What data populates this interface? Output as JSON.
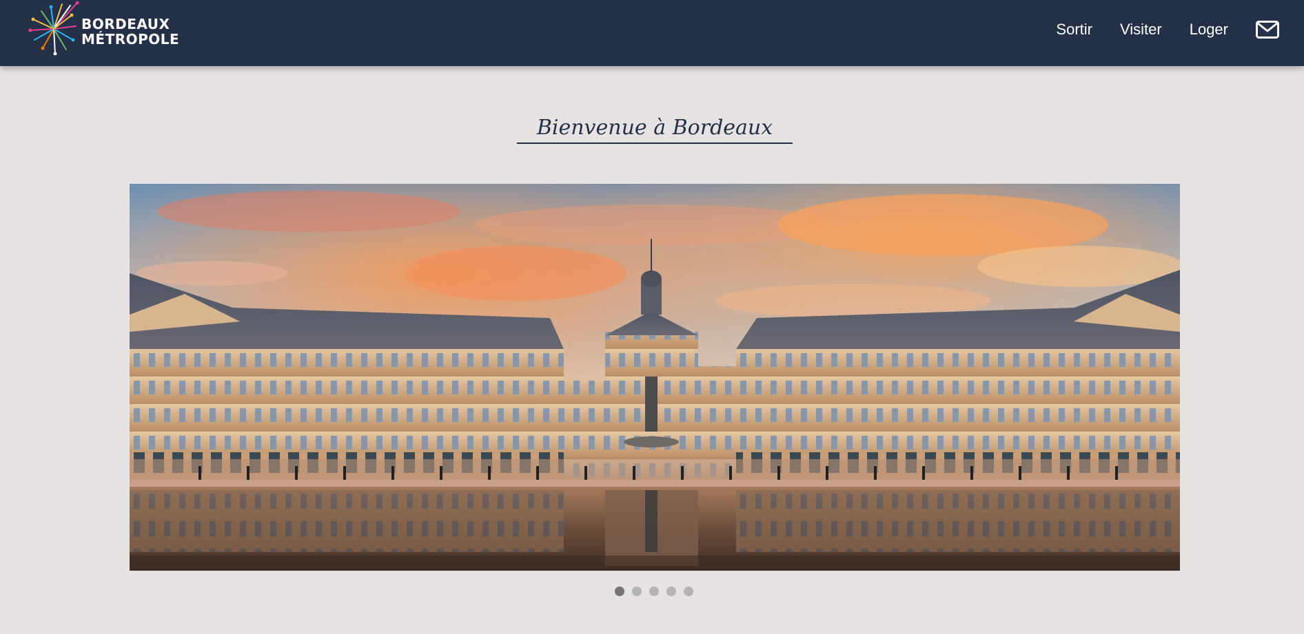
{
  "header": {
    "logo_line1": "BORDEAUX",
    "logo_line2": "MÉTROPOLE",
    "nav": [
      {
        "label": "Sortir"
      },
      {
        "label": "Visiter"
      },
      {
        "label": "Loger"
      }
    ],
    "contact_icon": "envelope-icon"
  },
  "main": {
    "title": "Bienvenue à Bordeaux",
    "carousel": {
      "slide_count": 5,
      "active_index": 0
    }
  },
  "colors": {
    "header_bg": "#243048",
    "page_bg": "#e7e3e2",
    "dot_active": "#777474",
    "dot_inactive": "#b6b3b3"
  }
}
